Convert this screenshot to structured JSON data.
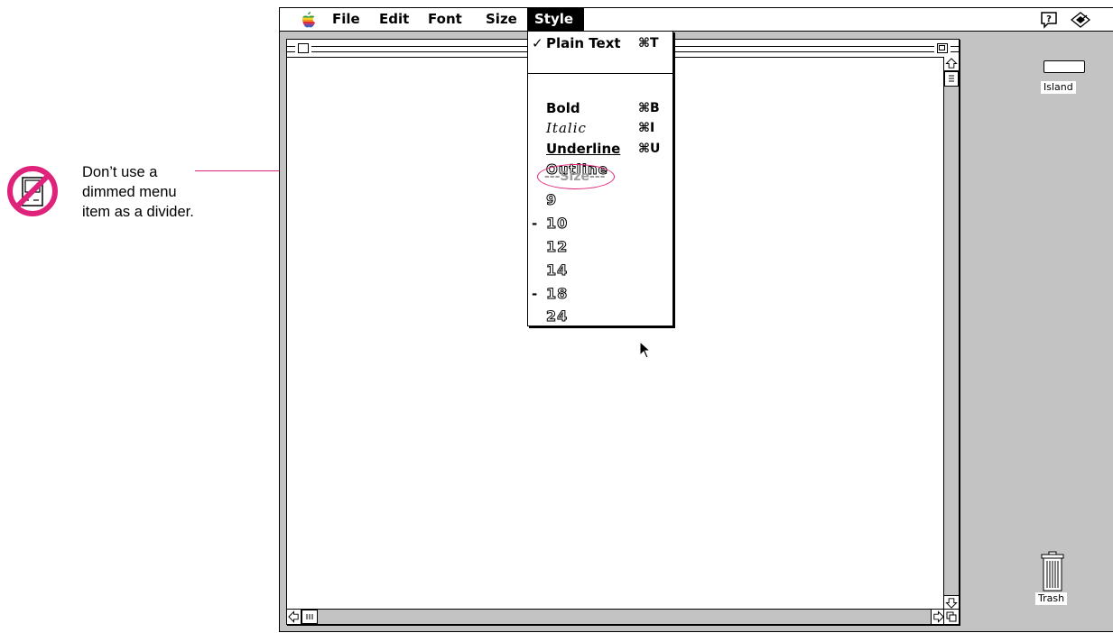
{
  "annotation": {
    "note": [
      "Don’t use a",
      "dimmed menu",
      "item as a divider."
    ],
    "sign_icon": "prohibited-computer-icon",
    "accent_color": "#e0237a"
  },
  "menubar": {
    "apple_icon": "apple-icon",
    "menus": [
      "File",
      "Edit",
      "Font",
      "Size",
      "Style"
    ],
    "active_menu": "Style",
    "right_icons": [
      "help-icon",
      "application-icon"
    ]
  },
  "style_menu": {
    "plain_text": {
      "check": "✓",
      "label": "Plain Text",
      "shortcut": "⌘T"
    },
    "bold": {
      "label": "Bold",
      "shortcut": "⌘B"
    },
    "italic": {
      "label": "Italic",
      "shortcut": "⌘I"
    },
    "underline": {
      "label": "Underline",
      "shortcut": "⌘U"
    },
    "outline": {
      "label": "Outline"
    },
    "dimmed_divider": {
      "label": "---Size---"
    },
    "sizes": [
      {
        "mark": "",
        "label": "9"
      },
      {
        "mark": "-",
        "label": "10"
      },
      {
        "mark": "",
        "label": "12"
      },
      {
        "mark": "",
        "label": "14"
      },
      {
        "mark": "-",
        "label": "18"
      },
      {
        "mark": "",
        "label": "24"
      }
    ]
  },
  "desktop": {
    "disk_label": "Island",
    "trash_label": "Trash"
  }
}
